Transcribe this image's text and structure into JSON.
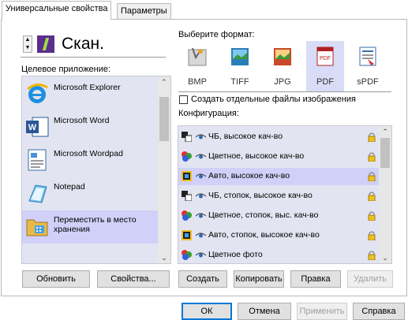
{
  "tabs": [
    {
      "label": "Универсальные свойства",
      "active": true
    },
    {
      "label": "Параметры",
      "active": false
    }
  ],
  "scan": {
    "name": "Скан.",
    "spin_up": "▲",
    "spin_down": "▼",
    "target_app_label": "Целевое приложение:"
  },
  "apps": [
    {
      "label": "Microsoft Explorer",
      "icon": "internet-explorer-icon",
      "selected": false
    },
    {
      "label": "Microsoft Word",
      "icon": "word-icon",
      "selected": false
    },
    {
      "label": "Microsoft Wordpad",
      "icon": "wordpad-icon",
      "selected": false
    },
    {
      "label": "Notepad",
      "icon": "notepad-icon",
      "selected": false
    },
    {
      "label": "Переместить в место хранения",
      "icon": "storage-folder-icon",
      "selected": true
    }
  ],
  "left_buttons": {
    "refresh": "Обновить",
    "properties": "Свойства..."
  },
  "format": {
    "label": "Выберите формат:",
    "items": [
      {
        "label": "BMP",
        "icon": "bmp-file-icon",
        "selected": false
      },
      {
        "label": "TIFF",
        "icon": "tiff-file-icon",
        "selected": false
      },
      {
        "label": "JPG",
        "icon": "jpg-file-icon",
        "selected": false
      },
      {
        "label": "PDF",
        "icon": "pdf-file-icon",
        "selected": true
      },
      {
        "label": "sPDF",
        "icon": "spdf-file-icon",
        "selected": false
      }
    ],
    "separate_files_label": "Создать отдельные файлы изображения",
    "separate_files_checked": false
  },
  "config": {
    "label": "Конфигурация:",
    "items": [
      {
        "label": "ЧБ, высокое кач-во",
        "icon": "bw-icon",
        "selected": false
      },
      {
        "label": "Цветное, высокое кач-во",
        "icon": "color-icon",
        "selected": false
      },
      {
        "label": "Авто, высокое кач-во",
        "icon": "auto-icon",
        "selected": true
      },
      {
        "label": "ЧБ, стопок, высокое кач-во",
        "icon": "bw-icon",
        "selected": false
      },
      {
        "label": "Цветное, стопок, выс. кач-во",
        "icon": "color-icon",
        "selected": false
      },
      {
        "label": "Авто, стопок, высокое кач-во",
        "icon": "auto-icon",
        "selected": false
      },
      {
        "label": "Цветное фото",
        "icon": "color-icon",
        "selected": false
      }
    ]
  },
  "config_buttons": {
    "create": "Создать",
    "copy": "Копировать",
    "edit": "Правка",
    "delete": "Удалить"
  },
  "dialog_buttons": {
    "ok": "ОК",
    "cancel": "Отмена",
    "apply": "Применить",
    "help": "Справка"
  },
  "colors": {
    "list_bg": "#e3e4f1",
    "selection": "#d0d0f8",
    "accent": "#0078d7"
  }
}
